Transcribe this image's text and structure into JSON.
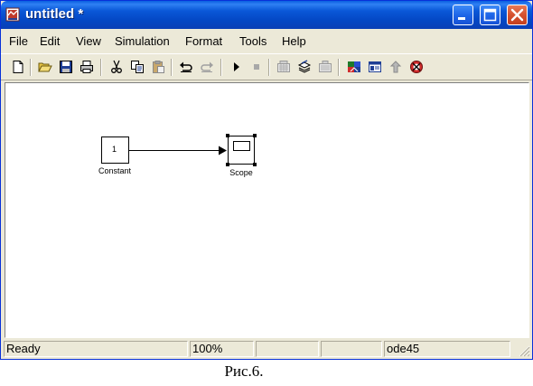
{
  "window": {
    "title": "untitled *"
  },
  "menu": {
    "items": [
      "File",
      "Edit",
      "View",
      "Simulation",
      "Format",
      "Tools",
      "Help"
    ]
  },
  "toolbar": {
    "icons": [
      "new-model-icon",
      "open-icon",
      "save-icon",
      "print-icon",
      "cut-icon",
      "copy-icon",
      "paste-icon",
      "undo-icon",
      "redo-icon",
      "start-simulation-icon",
      "stop-simulation-icon",
      "build-icon",
      "update-diagram-icon",
      "build-subsystem-icon",
      "library-browser-icon",
      "model-explorer-icon",
      "go-to-parent-icon",
      "debugger-icon"
    ]
  },
  "diagram": {
    "constant_block": {
      "value": "1",
      "label": "Constant"
    },
    "scope_block": {
      "label": "Scope"
    }
  },
  "status": {
    "text": "Ready",
    "zoom": "100%",
    "field_3": "",
    "field_4": "",
    "solver": "ode45"
  },
  "caption": "Рис.6.",
  "colors": {
    "titlebar": "#0a58d8",
    "window_face": "#ece9d8",
    "close_button": "#d5512f"
  }
}
